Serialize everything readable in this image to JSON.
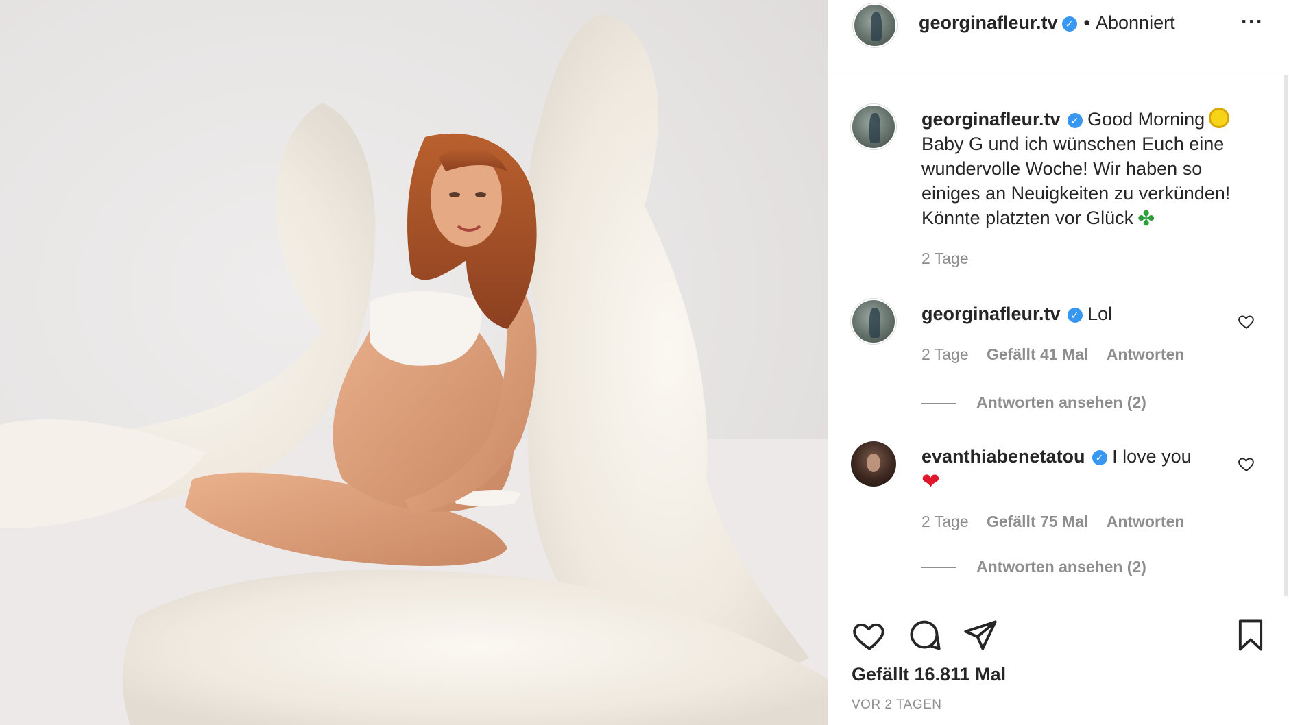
{
  "post": {
    "author": "georginafleur.tv",
    "follow_separator": "•",
    "follow_state": "Abonniert",
    "more_icon": "more-options-icon",
    "likes_text": "Gefällt 16.811 Mal",
    "date_text": "VOR 2 TAGEN"
  },
  "caption": {
    "username": "georginafleur.tv",
    "text_1": "Good Morning",
    "text_2": "Baby G und ich wünschen Euch eine wundervolle Woche! Wir haben so einiges an Neuigkeiten zu verkünden! Könnte platzten vor Glück",
    "time": "2 Tage"
  },
  "comments": [
    {
      "username": "georginafleur.tv",
      "text": "Lol",
      "time": "2 Tage",
      "likes": "Gefällt 41 Mal",
      "reply": "Antworten",
      "view_replies": "Antworten ansehen (2)"
    },
    {
      "username": "evanthiabenetatou",
      "text": "I love you",
      "time": "2 Tage",
      "likes": "Gefällt 75 Mal",
      "reply": "Antworten",
      "view_replies": "Antworten ansehen (2)"
    }
  ],
  "colors": {
    "verified_badge": "#3897f0",
    "text_primary": "#262626",
    "text_secondary": "#8e8e8e",
    "photo_background": "#e6e3e3"
  },
  "icons": [
    "like-heart-icon",
    "comment-icon",
    "share-direct-icon",
    "save-bookmark-icon",
    "verified-badge-icon",
    "comment-like-icon"
  ]
}
